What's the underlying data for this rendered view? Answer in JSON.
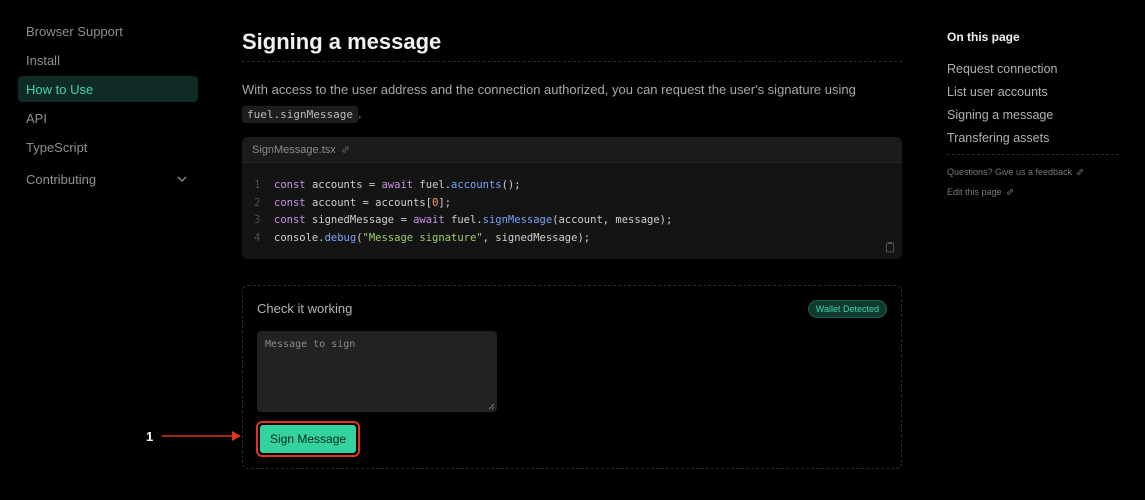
{
  "sidebar": {
    "items": [
      {
        "label": "Browser Support"
      },
      {
        "label": "Install"
      },
      {
        "label": "How to Use"
      },
      {
        "label": "API"
      },
      {
        "label": "TypeScript"
      },
      {
        "label": "Contributing"
      }
    ]
  },
  "main": {
    "title": "Signing a message",
    "intro": "With access to the user address and the connection authorized, you can request the user's signature using",
    "intro_code": "fuel.signMessage",
    "intro_end": ".",
    "code_file": "SignMessage.tsx",
    "code_lines": {
      "l1": {
        "n": "1",
        "a": "const ",
        "b": "accounts",
        "c": " = ",
        "d": "await ",
        "e": "fuel.",
        "f": "accounts",
        "g": "();"
      },
      "l2": {
        "n": "2",
        "a": "const ",
        "b": "account",
        "c": " = accounts[",
        "d": "0",
        "e": "];"
      },
      "l3": {
        "n": "3",
        "a": "const ",
        "b": "signedMessage",
        "c": " = ",
        "d": "await ",
        "e": "fuel.",
        "f": "signMessage",
        "g": "(account, message);"
      },
      "l4": {
        "n": "4",
        "a": "console.",
        "b": "debug",
        "c": "(",
        "d": "\"Message signature\"",
        "e": ", signedMessage);"
      }
    },
    "demo": {
      "title": "Check it working",
      "badge": "Wallet Detected",
      "input_placeholder": "Message to sign",
      "button_label": "Sign Message"
    }
  },
  "annotation": {
    "number": "1",
    "color": "#e0361f"
  },
  "toc": {
    "title": "On this page",
    "items": [
      {
        "label": "Request connection"
      },
      {
        "label": "List user accounts"
      },
      {
        "label": "Signing a message"
      },
      {
        "label": "Transfering assets"
      }
    ],
    "feedback": "Questions? Give us a feedback",
    "edit": "Edit this page"
  },
  "colors": {
    "accent": "#34d39e",
    "active_bg": "#102a26",
    "background": "#000000"
  }
}
